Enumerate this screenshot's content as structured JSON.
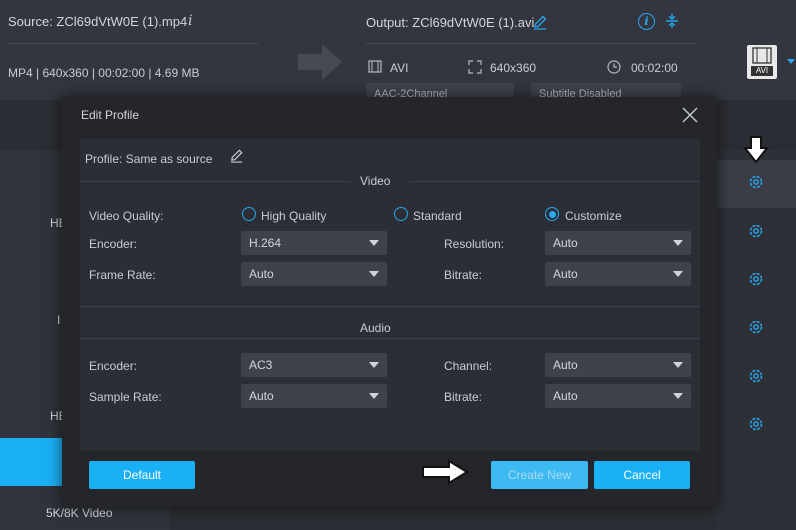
{
  "source": {
    "label": "Source: ZCl69dVtW0E (1).mp4",
    "meta": "MP4 | 640x360 | 00:02:00 | 4.69 MB"
  },
  "output": {
    "label": "Output: ZCl69dVtW0E (1).avi",
    "format": "AVI",
    "resolution": "640x360",
    "duration": "00:02:00",
    "format_badge": "AVI",
    "audio_dropdown": "AAC-2Channel",
    "subtitle_dropdown": "Subtitle Disabled"
  },
  "left_panel": {
    "labels": [
      "HE",
      "I",
      "HE",
      "5K/8K Video"
    ]
  },
  "dialog": {
    "title": "Edit Profile",
    "profile_label": "Profile:",
    "profile_value": "Same as source",
    "video_section": "Video",
    "audio_section": "Audio",
    "video": {
      "quality_label": "Video Quality:",
      "quality_options": [
        "High Quality",
        "Standard",
        "Customize"
      ],
      "quality_selected": "Customize",
      "encoder_label": "Encoder:",
      "encoder_value": "H.264",
      "resolution_label": "Resolution:",
      "resolution_value": "Auto",
      "framerate_label": "Frame Rate:",
      "framerate_value": "Auto",
      "bitrate_label": "Bitrate:",
      "bitrate_value": "Auto"
    },
    "audio": {
      "encoder_label": "Encoder:",
      "encoder_value": "AC3",
      "channel_label": "Channel:",
      "channel_value": "Auto",
      "samplerate_label": "Sample Rate:",
      "samplerate_value": "Auto",
      "bitrate_label": "Bitrate:",
      "bitrate_value": "Auto"
    },
    "buttons": {
      "default": "Default",
      "create_new": "Create New",
      "cancel": "Cancel"
    }
  },
  "icons": {
    "info": "info-icon",
    "edit": "pencil-icon",
    "settings": "gear-icon",
    "close": "close-icon",
    "arrow": "arrow-right-icon"
  },
  "colors": {
    "accent": "#1ab0f5",
    "background": "#2b2d34",
    "dialog": "#24262c"
  }
}
